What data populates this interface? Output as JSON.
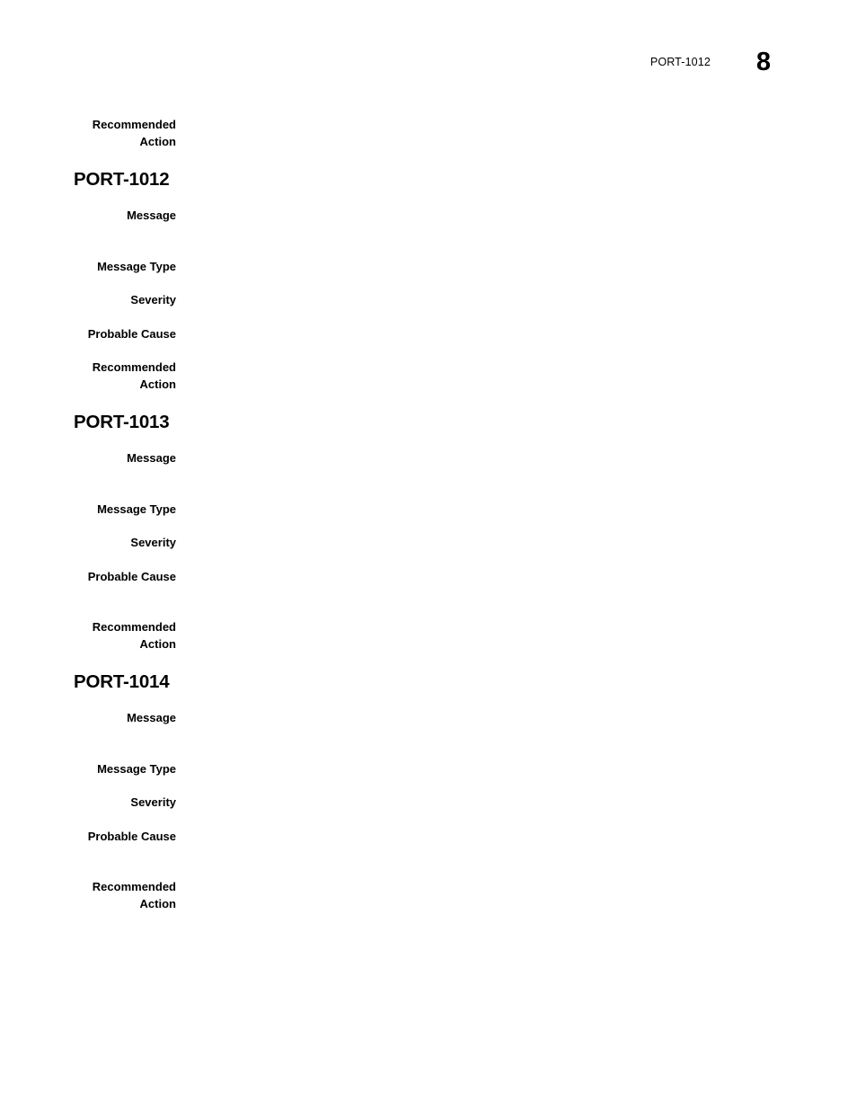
{
  "header": {
    "section_title": "PORT-1012",
    "page_number": "8"
  },
  "labels": {
    "message": "Message",
    "message_type": "Message Type",
    "severity": "Severity",
    "probable_cause": "Probable Cause",
    "recommended_action": "Recommended Action"
  },
  "continued_entry": {
    "recommended_action_label": "Recommended Action",
    "recommended_action_value": ""
  },
  "sections": [
    {
      "id": "PORT-1012",
      "heading": "PORT-1012",
      "fields": [
        {
          "label": "Message",
          "value": ""
        },
        {
          "label": "Message Type",
          "value": ""
        },
        {
          "label": "Severity",
          "value": ""
        },
        {
          "label": "Probable Cause",
          "value": ""
        },
        {
          "label": "Recommended Action",
          "value": ""
        }
      ]
    },
    {
      "id": "PORT-1013",
      "heading": "PORT-1013",
      "fields": [
        {
          "label": "Message",
          "value": ""
        },
        {
          "label": "Message Type",
          "value": ""
        },
        {
          "label": "Severity",
          "value": ""
        },
        {
          "label": "Probable Cause",
          "value": ""
        },
        {
          "label": "Recommended Action",
          "value": ""
        }
      ]
    },
    {
      "id": "PORT-1014",
      "heading": "PORT-1014",
      "fields": [
        {
          "label": "Message",
          "value": ""
        },
        {
          "label": "Message Type",
          "value": ""
        },
        {
          "label": "Severity",
          "value": ""
        },
        {
          "label": "Probable Cause",
          "value": ""
        },
        {
          "label": "Recommended Action",
          "value": ""
        }
      ]
    }
  ]
}
